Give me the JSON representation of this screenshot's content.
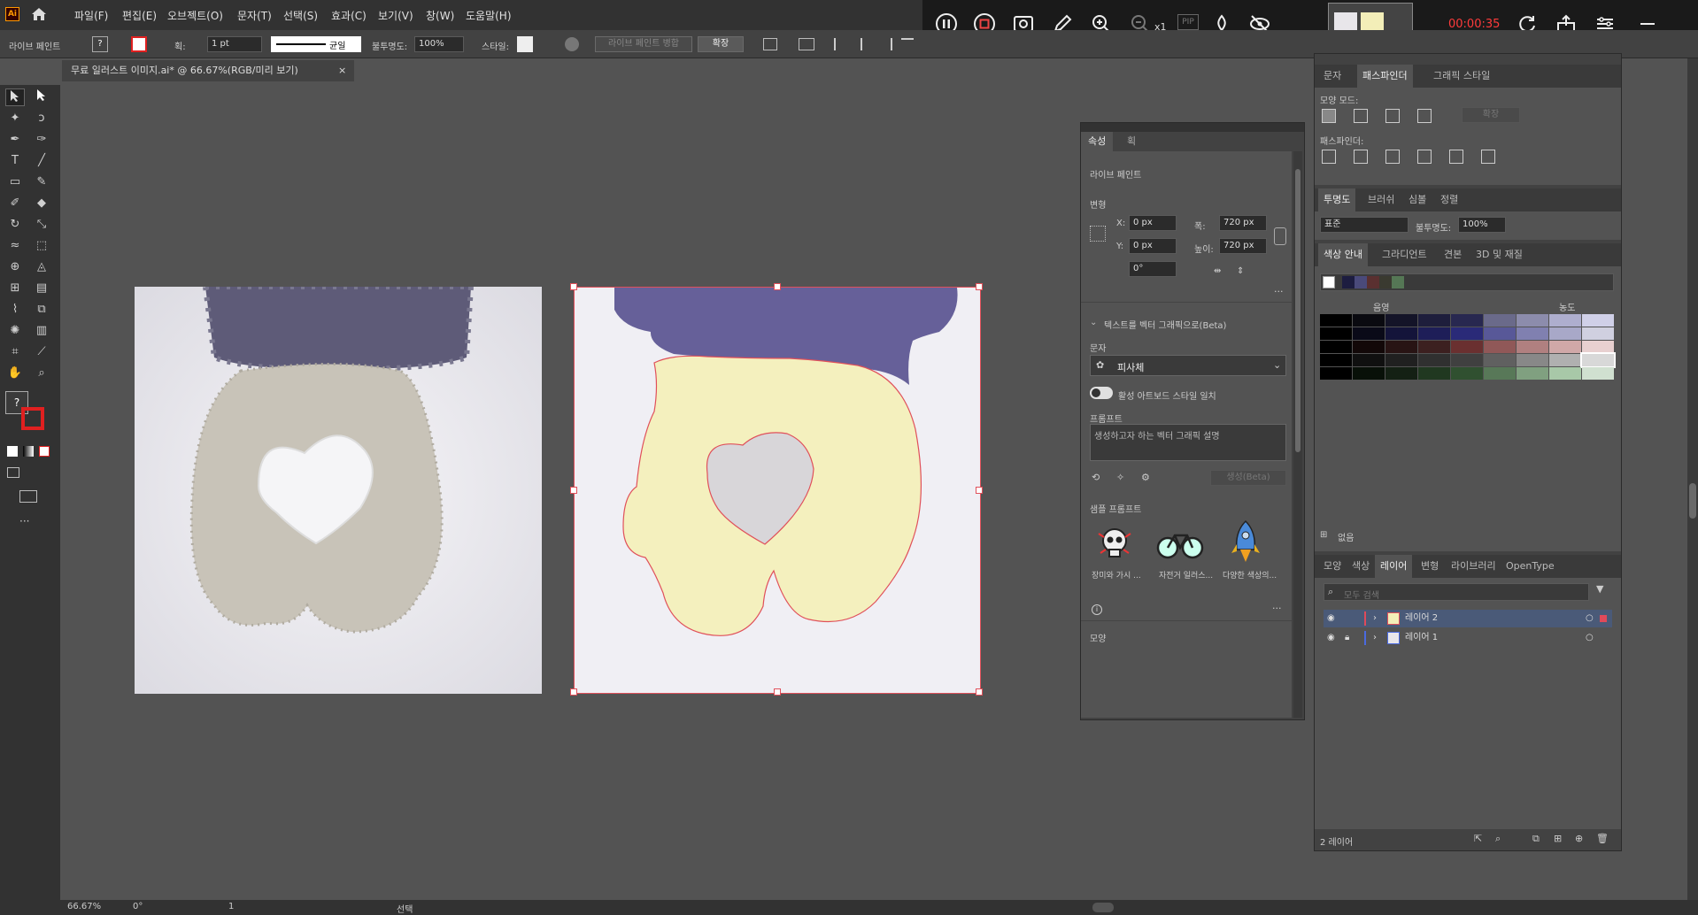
{
  "menubar": {
    "logo": "Ai",
    "items": [
      "파일(F)",
      "편집(E)",
      "오브젝트(O)",
      "문자(T)",
      "선택(S)",
      "효과(C)",
      "보기(V)",
      "창(W)",
      "도움말(H)"
    ]
  },
  "controlbar": {
    "mode_label": "라이브 페인트",
    "stroke_label": "획:",
    "stroke_value": "1 pt",
    "stroke_style": "균일",
    "opacity_label": "불투명도:",
    "opacity_value": "100%",
    "style_label": "스타일:",
    "merge_button": "라이브 페인트 병합",
    "expand_button": "확장"
  },
  "document": {
    "tab_title": "무료 일러스트 이미지.ai* @ 66.67%(RGB/미리 보기)",
    "close": "×"
  },
  "recorder": {
    "timer": "00:00:35",
    "zoom_multiplier": "x1",
    "pip": "PIP",
    "colors": {
      "timer": "#ff3b3b",
      "background": "#1a1a1a"
    }
  },
  "properties": {
    "tabs": [
      "속성",
      "획"
    ],
    "section_title": "라이브 페인트",
    "transform_title": "변형",
    "x_label": "X:",
    "x_value": "0 px",
    "y_label": "Y:",
    "y_value": "0 px",
    "w_label": "폭:",
    "w_value": "720 px",
    "h_label": "높이:",
    "h_value": "720 px",
    "angle_value": "0°",
    "text_to_vector": "텍스트를 벡터 그래픽으로(Beta)",
    "type_label": "문자",
    "type_value": "피사체",
    "match_style": "활성 아트보드 스타일 일치",
    "prompt_label": "프롬프트",
    "prompt_placeholder": "생성하고자 하는 벡터 그래픽 설명",
    "generate_button": "생성(Beta)",
    "samples_label": "샘플 프롬프트",
    "samples": [
      {
        "icon": "skull-icon",
        "caption": "장미와 가시 ..."
      },
      {
        "icon": "bicycle-icon",
        "caption": "자전거 일러스..."
      },
      {
        "icon": "rocket-icon",
        "caption": "다양한 색상의..."
      }
    ],
    "appearance_label": "모양"
  },
  "rightpanel": {
    "top_tabs": [
      "문자",
      "패스파인더",
      "그래픽 스타일"
    ],
    "shape_modes_label": "모양 모드:",
    "pathfinder_label": "패스파인더:",
    "expand_button": "확장",
    "transparency_tabs": [
      "투명도",
      "브러쉬",
      "심볼",
      "정렬"
    ],
    "blend_mode": "표준",
    "opacity_label": "불투명도:",
    "opacity_value": "100%",
    "color_guide_tabs": [
      "색상 안내",
      "그라디언트",
      "견본",
      "3D 및 재질"
    ],
    "shade_label": "음영",
    "tint_label": "농도",
    "none_label": "없음",
    "layer_tabs": [
      "모양",
      "색상",
      "레이어",
      "변형",
      "라이브러리",
      "OpenType"
    ],
    "search_placeholder": "모두 검색",
    "layers": [
      {
        "name": "레이어 2",
        "color": "#e04a5a"
      },
      {
        "name": "레이어 1",
        "color": "#4a6ae0"
      }
    ],
    "layer_count": "2 레이어"
  },
  "statusbar": {
    "zoom": "66.67%",
    "rotation": "0°",
    "artboard": "1",
    "tool": "선택"
  },
  "palette": {
    "harmony": [
      "#ffffff",
      "#1d1d40",
      "#4a4a7a",
      "#5a3030",
      "#3a3a30",
      "#557755"
    ],
    "grid": [
      [
        "#000000",
        "#0a0a10",
        "#141428",
        "#1e1e3c",
        "#282850",
        "#6a6a8a",
        "#8c8cac",
        "#aeaece",
        "#d0d0e8"
      ],
      [
        "#000000",
        "#0a0a18",
        "#14143a",
        "#1e1e58",
        "#2a2a78",
        "#585898",
        "#8080b0",
        "#a8a8c8",
        "#d0d0e0"
      ],
      [
        "#000000",
        "#120808",
        "#281414",
        "#3c2020",
        "#6a3030",
        "#905858",
        "#b08080",
        "#d0a8a8",
        "#e8d0d0"
      ],
      [
        "#000000",
        "#101010",
        "#202020",
        "#303030",
        "#404040",
        "#606060",
        "#888888",
        "#b0b0b0",
        "#d8d8d8"
      ],
      [
        "#000000",
        "#081008",
        "#142014",
        "#203820",
        "#305030",
        "#587858",
        "#80a080",
        "#a8c8a8",
        "#d0e0d0"
      ]
    ]
  }
}
